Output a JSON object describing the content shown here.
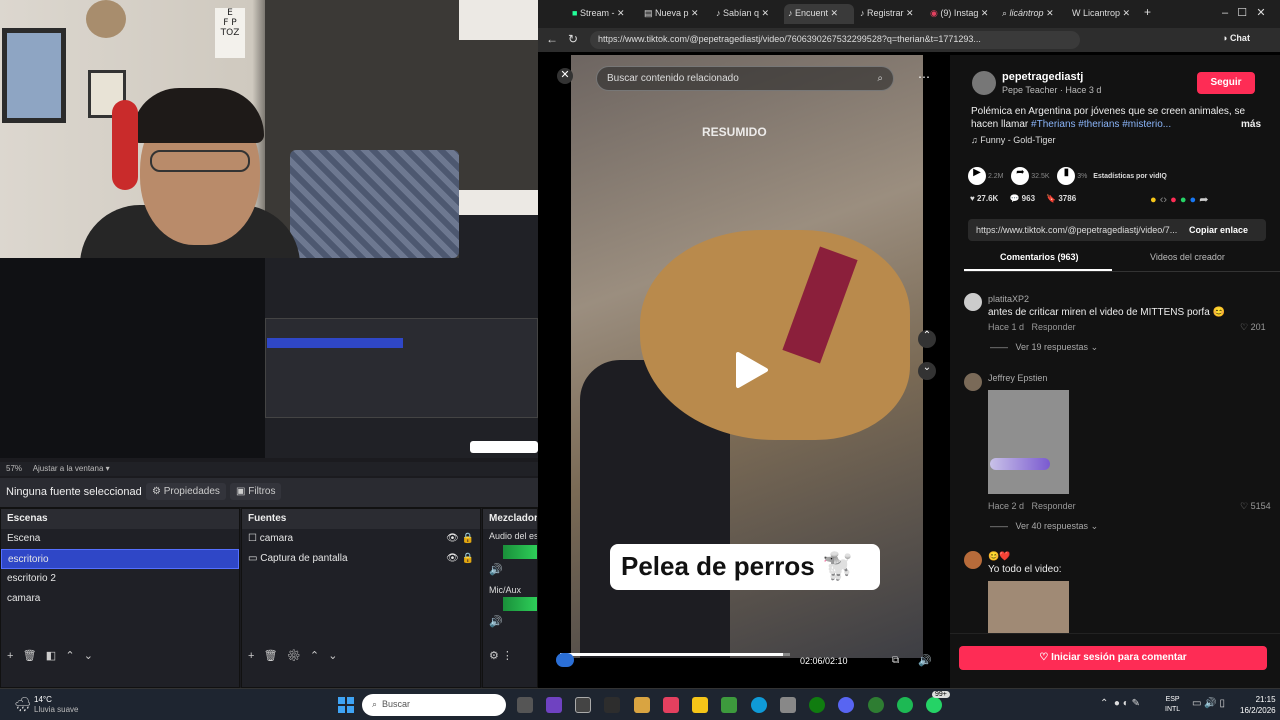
{
  "browser": {
    "tabs": [
      {
        "label": "Stream -"
      },
      {
        "label": "Nueva p"
      },
      {
        "label": "Sabían q"
      },
      {
        "label": "Encuent"
      },
      {
        "label": "Registrar"
      },
      {
        "label": "(9) Instag"
      },
      {
        "label": "licántrop"
      },
      {
        "label": "Licantrop"
      }
    ],
    "url": "https://www.tiktok.com/@pepetragediastj/video/7606390267532299528?q=therian&t=1771293...",
    "chat_label": "Chat"
  },
  "video": {
    "search_placeholder": "Buscar contenido relacionado",
    "watermark": "RESUMIDO",
    "caption": "Pelea de perros 🐩",
    "time": "02:06/02:10",
    "progress": 0.97
  },
  "post": {
    "username": "pepetragediastj",
    "subtitle": "Pepe Teacher · Hace 3 d",
    "follow": "Seguir",
    "description": "Polémica en Argentina por jóvenes que se creen animales, se hacen llamar",
    "hashtags": "#Therians #therians #misterio...",
    "more": "más",
    "music": "♫ Funny - Gold-Tiger",
    "stats_small": [
      "2.2M",
      "32.5K",
      "3%"
    ],
    "stats_label": "Estadísticas por vidIQ",
    "likes": "27.6K",
    "comments": "963",
    "saves": "3786",
    "share_url": "https://www.tiktok.com/@pepetragediastj/video/7...",
    "copy": "Copiar enlace",
    "tab_comments": "Comentarios (963)",
    "tab_videos": "Videos del creador",
    "login": "Iniciar sesión para comentar"
  },
  "comments": [
    {
      "user": "platitaXP2",
      "text": "antes de criticar miren el video de MITTENS porfa 😊",
      "time": "Hace 1 d",
      "reply": "Responder",
      "likes": "201",
      "replies": "Ver 19 respuestas"
    },
    {
      "user": "Jeffrey Epstien",
      "text": "",
      "time": "Hace 2 d",
      "reply": "Responder",
      "likes": "5154",
      "replies": "Ver 40 respuestas"
    },
    {
      "user": "😊❤️",
      "text": "Yo todo el video:",
      "time": "",
      "reply": "",
      "likes": "",
      "replies": ""
    }
  ],
  "obs": {
    "zoom": "57%",
    "fit": "Ajustar a la ventana",
    "no_source": "Ninguna fuente seleccionad",
    "properties": "Propiedades",
    "filters": "Filtros",
    "scenes_title": "Escenas",
    "scenes": [
      "Escena",
      "escritorio",
      "escritorio 2",
      "camara"
    ],
    "sources_title": "Fuentes",
    "sources": [
      "camara",
      "Captura de pantalla"
    ],
    "mixer_title": "Mezclador d",
    "mixer": [
      "Audio del esc",
      "Mic/Aux"
    ]
  },
  "taskbar": {
    "weather_temp": "14°C",
    "weather_desc": "Lluvia suave",
    "search": "Buscar",
    "lang": "ESP",
    "lang2": "INTL",
    "time": "21:15",
    "date": "16/2/2026",
    "badge": "99+"
  }
}
